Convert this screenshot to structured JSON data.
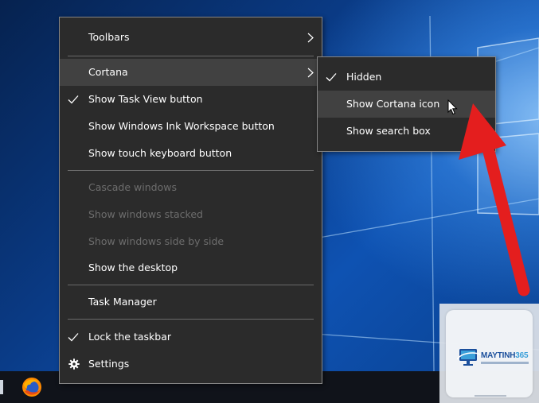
{
  "context_menu": {
    "items": [
      {
        "label": "Toolbars"
      },
      {
        "label": "Cortana"
      },
      {
        "label": "Show Task View button"
      },
      {
        "label": "Show Windows Ink Workspace button"
      },
      {
        "label": "Show touch keyboard button"
      },
      {
        "label": "Cascade windows"
      },
      {
        "label": "Show windows stacked"
      },
      {
        "label": "Show windows side by side"
      },
      {
        "label": "Show the desktop"
      },
      {
        "label": "Task Manager"
      },
      {
        "label": "Lock the taskbar"
      },
      {
        "label": "Settings"
      }
    ],
    "checked": [
      "Show Task View button",
      "Lock the taskbar"
    ],
    "disabled": [
      "Cascade windows",
      "Show windows stacked",
      "Show windows side by side"
    ],
    "highlighted": "Cortana"
  },
  "cortana_submenu": {
    "items": [
      {
        "label": "Hidden"
      },
      {
        "label": "Show Cortana icon"
      },
      {
        "label": "Show search box"
      }
    ],
    "checked": "Hidden",
    "highlighted": "Show Cortana icon"
  },
  "taskbar": {
    "pinned_apps": [
      {
        "icon": "firefox-icon"
      }
    ]
  },
  "annotation": {
    "arrow_color": "#e41e1e",
    "points_to": "Show Cortana icon"
  },
  "watermark": {
    "brand_part1": "MAYTINH",
    "brand_part2": "365"
  },
  "colors": {
    "menu_background": "#2b2b2b",
    "menu_hover": "#414141",
    "menu_border": "#868686",
    "disabled_text": "#6d6d6d"
  }
}
